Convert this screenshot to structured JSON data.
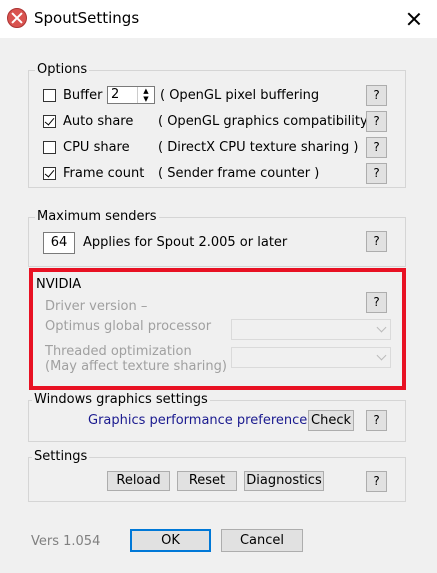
{
  "window": {
    "title": "SpoutSettings"
  },
  "options": {
    "label": "Options",
    "buffer_label": "Buffer",
    "buffer_value": "2",
    "buffer_desc": "( OpenGL pixel buffering",
    "auto_share_label": "Auto share",
    "auto_share_desc": "( OpenGL graphics compatibility",
    "cpu_share_label": "CPU share",
    "cpu_share_desc": "( DirectX CPU texture sharing )",
    "frame_count_label": "Frame count",
    "frame_count_desc": "( Sender frame counter )",
    "help": "?"
  },
  "max_senders": {
    "label": "Maximum senders",
    "value": "64",
    "desc": "Applies for Spout 2.005 or later",
    "help": "?"
  },
  "nvidia": {
    "label": "NVIDIA",
    "driver_version": "Driver version –",
    "optimus_label": "Optimus global processor",
    "threaded_label": "Threaded optimization",
    "threaded_sub": "(May affect texture sharing)",
    "help": "?"
  },
  "graphics_settings": {
    "label": "Windows graphics settings",
    "link": "Graphics performance preference",
    "check": "Check",
    "help": "?"
  },
  "settings": {
    "label": "Settings",
    "reload": "Reload",
    "reset": "Reset",
    "diagnostics": "Diagnostics",
    "help": "?"
  },
  "footer": {
    "version": "Vers 1.054",
    "ok": "OK",
    "cancel": "Cancel"
  },
  "colors": {
    "highlight": "#e81123",
    "focus": "#0078d7",
    "link": "#1a1a8f"
  }
}
